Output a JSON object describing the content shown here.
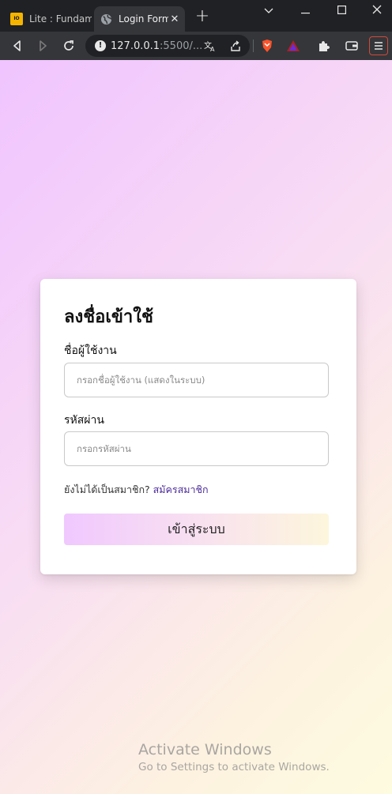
{
  "browser": {
    "tabs": [
      {
        "title": "Lite : Fundame",
        "active": false,
        "icon": "site-logo-icon"
      },
      {
        "title": "Login Form",
        "active": true,
        "icon": "globe-icon"
      }
    ],
    "new_tab_label": "+",
    "address": {
      "host": "127.0.0.1",
      "rest": ":5500/..."
    },
    "toolbar_icons": [
      "back-icon",
      "forward-icon",
      "reload-icon",
      "info-icon",
      "translate-icon",
      "share-icon",
      "brave-shield-icon",
      "brave-rewards-icon",
      "extensions-icon",
      "wallet-icon",
      "menu-icon"
    ]
  },
  "login": {
    "title": "ลงชื่อเข้าใช้",
    "username_label": "ชื่อผู้ใช้งาน",
    "username_placeholder": "กรอกชื่อผู้ใช้งาน (แสดงในระบบ)",
    "password_label": "รหัสผ่าน",
    "password_placeholder": "กรอกรหัสผ่าน",
    "signup_prompt": "ยังไม่ได้เป็นสมาชิก?",
    "signup_link": "สมัครสมาชิก",
    "submit_label": "เข้าสู่ระบบ"
  },
  "watermark": {
    "line1": "Activate Windows",
    "line2": "Go to Settings to activate Windows."
  },
  "colors": {
    "browser_frame": "#202124",
    "toolbar": "#35363a",
    "gradient_start": "#f0c4ff",
    "gradient_end": "#fdfbe0",
    "link": "#4a2a9a"
  }
}
